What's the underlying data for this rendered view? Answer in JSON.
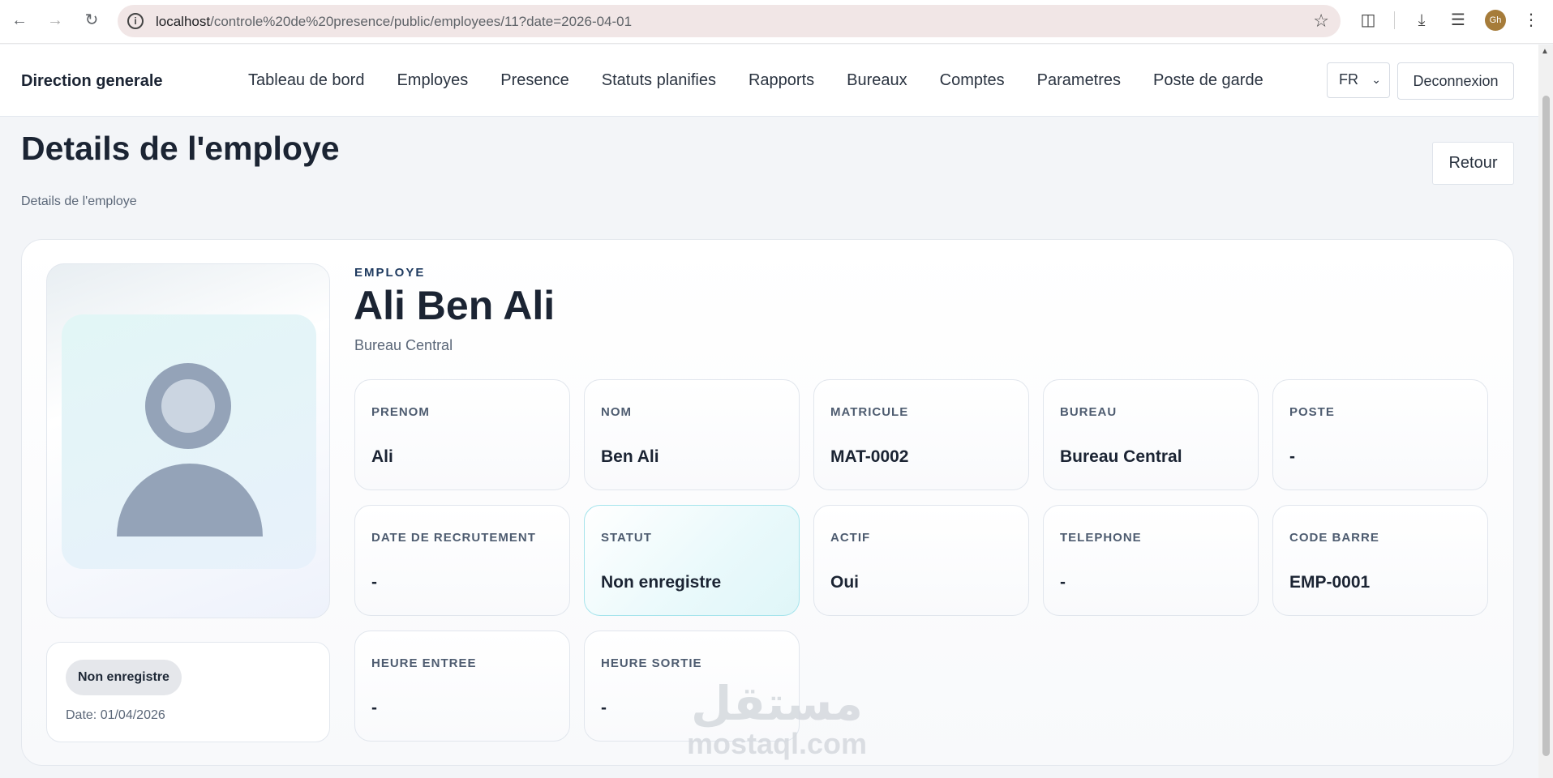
{
  "browser": {
    "url_host": "localhost",
    "url_path": "/controle%20de%20presence/public/employees/11?date=2026-04-01",
    "profile_initials": "Gh"
  },
  "app": {
    "brand": "Direction generale",
    "menu": [
      {
        "label": "Tableau de bord"
      },
      {
        "label": "Employes"
      },
      {
        "label": "Presence"
      },
      {
        "label": "Statuts planifies"
      },
      {
        "label": "Rapports"
      },
      {
        "label": "Bureaux"
      },
      {
        "label": "Comptes"
      },
      {
        "label": "Parametres"
      },
      {
        "label": "Poste de garde"
      }
    ],
    "language": "FR",
    "logout_label": "Deconnexion"
  },
  "page": {
    "title": "Details de l'employe",
    "breadcrumb": "Details de l'employe",
    "back_label": "Retour"
  },
  "employee": {
    "kicker": "EMPLOYE",
    "full_name": "Ali Ben Ali",
    "office": "Bureau Central",
    "status_badge": "Non enregistre",
    "status_date": "Date: 01/04/2026",
    "fields": [
      {
        "label": "PRENOM",
        "value": "Ali"
      },
      {
        "label": "NOM",
        "value": "Ben Ali"
      },
      {
        "label": "MATRICULE",
        "value": "MAT-0002"
      },
      {
        "label": "BUREAU",
        "value": "Bureau Central"
      },
      {
        "label": "POSTE",
        "value": "-"
      },
      {
        "label": "DATE DE RECRUTEMENT",
        "value": "-"
      },
      {
        "label": "STATUT",
        "value": "Non enregistre"
      },
      {
        "label": "ACTIF",
        "value": "Oui"
      },
      {
        "label": "TELEPHONE",
        "value": "-"
      },
      {
        "label": "CODE BARRE",
        "value": "EMP-0001"
      },
      {
        "label": "HEURE ENTREE",
        "value": "-"
      },
      {
        "label": "HEURE SORTIE",
        "value": "-"
      }
    ]
  },
  "watermark": {
    "arabic": "مستقل",
    "latin": "mostaql.com"
  },
  "icons": {
    "back": "arrow-left-icon",
    "forward": "arrow-right-icon",
    "reload": "reload-icon",
    "site_info": "info-icon",
    "bookmark": "star-icon",
    "extensions": "puzzle-icon",
    "download": "download-icon",
    "media": "playlist-icon",
    "menu": "kebab-menu-icon"
  }
}
